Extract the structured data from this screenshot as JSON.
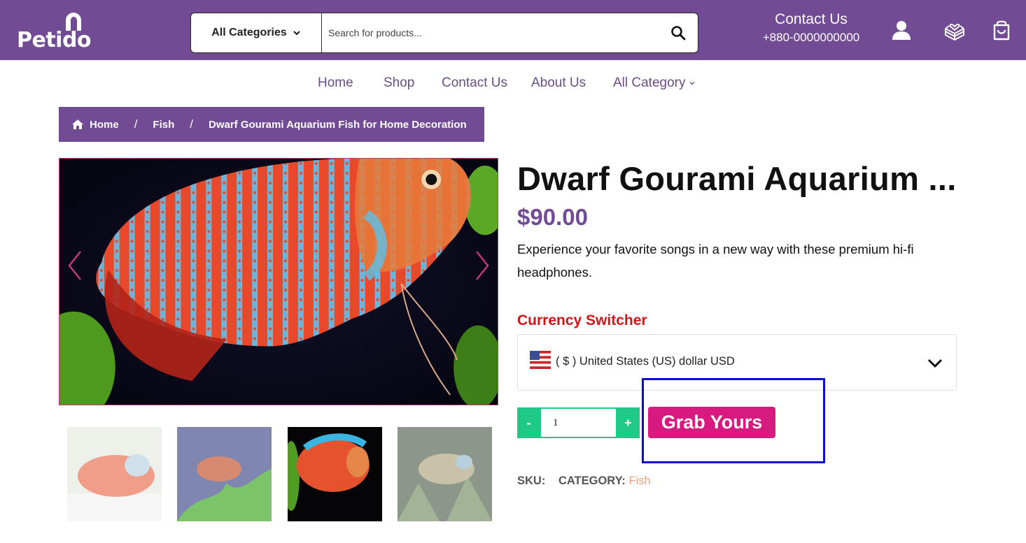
{
  "header": {
    "logo_text": "Petido",
    "search": {
      "category_label": "All Categories",
      "placeholder": "Search for products..."
    },
    "contact": {
      "title": "Contact Us",
      "phone": "+880-0000000000"
    },
    "icons": [
      "user-icon",
      "gift-box-icon",
      "shopping-bag-icon"
    ],
    "colors": {
      "brand": "#714b93"
    }
  },
  "nav": {
    "items": [
      {
        "label": "Home"
      },
      {
        "label": "Shop"
      },
      {
        "label": "Contact Us"
      },
      {
        "label": "About Us"
      },
      {
        "label": "All Category"
      }
    ]
  },
  "breadcrumb": {
    "items": [
      {
        "label": "Home"
      },
      {
        "label": "Fish"
      },
      {
        "label": "Dwarf Gourami Aquarium Fish for Home Decoration"
      }
    ],
    "separator": "/"
  },
  "product": {
    "title": "Dwarf Gourami Aquarium ...",
    "price": "$90.00",
    "description": "Experience your favorite songs in a new way with these premium hi-fi headphones.",
    "currency_switcher": {
      "title": "Currency Switcher",
      "selected": "( $ ) United States (US) dollar USD"
    },
    "quantity": {
      "minus_label": "-",
      "value": "1",
      "plus_label": "+"
    },
    "add_button_label": "Grab Yours",
    "meta": {
      "sku_label": "SKU:",
      "category_label": "CATEGORY:",
      "category_value": "Fish"
    },
    "gallery": {
      "thumbnail_count": 4,
      "active_thumbnail": 3
    },
    "colors": {
      "price": "#714b93",
      "currency_title": "#d31515",
      "quantity": "#20c986",
      "add_button": "#d8197f",
      "category_link": "#eea284"
    }
  }
}
